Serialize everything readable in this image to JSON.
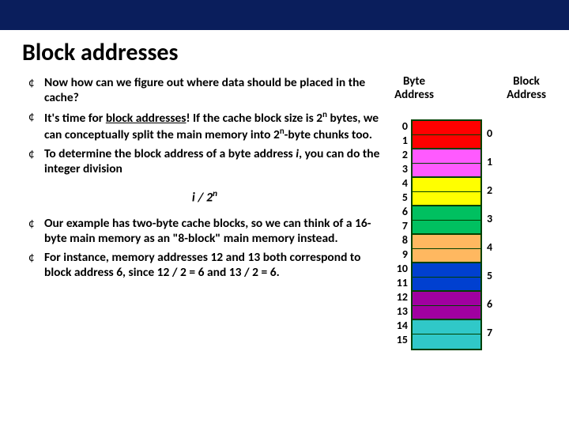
{
  "title": "Block addresses",
  "bullets": {
    "b1": "Now how can we figure out where data should be placed in the cache?",
    "b2_pre": "It's time for ",
    "b2_u": "block addresses",
    "b2_mid": "! If the cache block size is 2",
    "b2_sup1": "n",
    "b2_mid2": " bytes, we can conceptually split the main memory into 2",
    "b2_sup2": "n",
    "b2_post": "-byte chunks too.",
    "b3_pre": "To determine the block address of a byte address ",
    "b3_i": "i",
    "b3_post": ", you can do the integer division",
    "b4": "Our example has two-byte cache blocks, so we can think of a 16-byte main memory as an \"8-block\" main memory instead.",
    "b5_pre": "For instance, memory addresses ",
    "b5_a": "12",
    "b5_mid1": " and ",
    "b5_b": "13",
    "b5_mid2": " both correspond to block address ",
    "b5_c": "6",
    "b5_mid3": ", since ",
    "b5_d": "12 / 2 = 6",
    "b5_mid4": " and ",
    "b5_e": "13 / 2 = 6",
    "b5_post": "."
  },
  "formula": {
    "i": "i",
    "slash": " / 2",
    "n": "n"
  },
  "labels": {
    "byte_l1": "Byte",
    "byte_l2": "Address",
    "block_l1": "Block",
    "block_l2": "Address"
  },
  "bytes": [
    "0",
    "1",
    "2",
    "3",
    "4",
    "5",
    "6",
    "7",
    "8",
    "9",
    "10",
    "11",
    "12",
    "13",
    "14",
    "15"
  ],
  "blocks": [
    "0",
    "1",
    "2",
    "3",
    "4",
    "5",
    "6",
    "7"
  ]
}
